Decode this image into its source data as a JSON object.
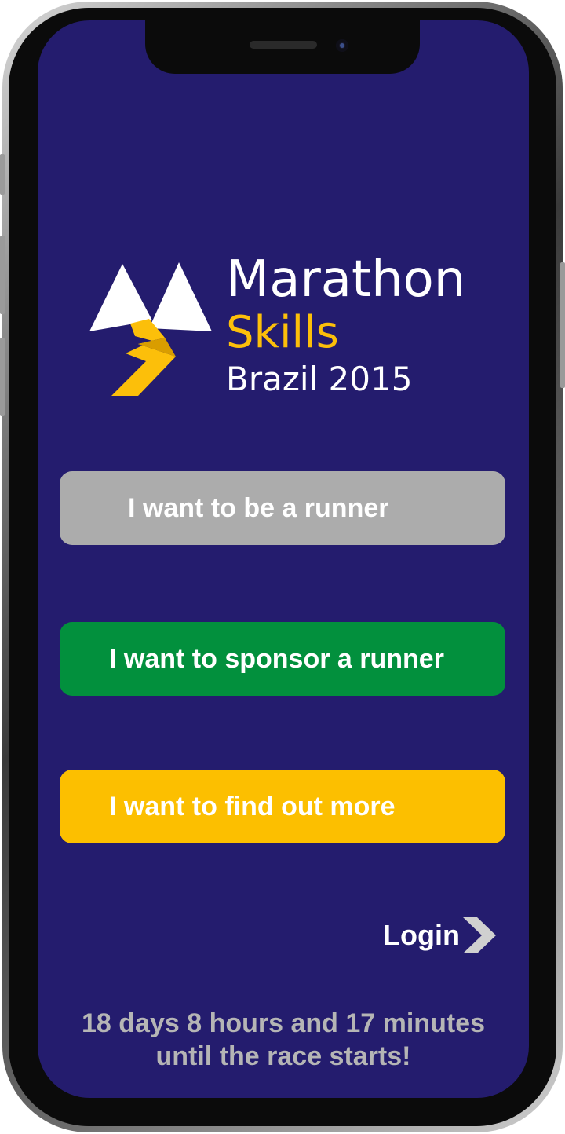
{
  "app": {
    "background_color": "#241c6e"
  },
  "logo": {
    "line1": "Marathon",
    "line2": "Skills",
    "line3": "Brazil 2015",
    "icon": "marathon-skills-mountains-logo-icon",
    "accent_color": "#fcbf0a"
  },
  "buttons": {
    "runner": {
      "label": "I want to be a runner",
      "color": "#acacac"
    },
    "sponsor": {
      "label": "I want to sponsor a runner",
      "color": "#02903d"
    },
    "more": {
      "label": "I want to find out more",
      "color": "#fcbf00"
    }
  },
  "login": {
    "label": "Login",
    "icon": "chevron-right-icon"
  },
  "countdown": {
    "line1": "18 days 8 hours and 17 minutes",
    "line2": "until the race starts!"
  }
}
